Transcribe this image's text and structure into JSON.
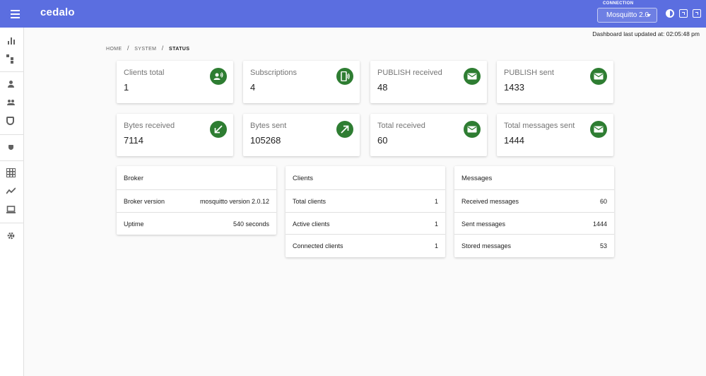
{
  "app": {
    "logo": "cedalo"
  },
  "connection": {
    "label": "CONNECTION",
    "selected": "Mosquitto 2.0"
  },
  "status": {
    "last_updated": "Dashboard last updated at: 02:05:48 pm"
  },
  "breadcrumb": {
    "items": [
      "HOME",
      "SYSTEM"
    ],
    "current": "STATUS"
  },
  "stats": [
    {
      "label": "Clients total",
      "value": "1",
      "icon": "person-voice-icon"
    },
    {
      "label": "Subscriptions",
      "value": "4",
      "icon": "phonelink-ring-icon"
    },
    {
      "label": "PUBLISH received",
      "value": "48",
      "icon": "mail-icon"
    },
    {
      "label": "PUBLISH sent",
      "value": "1433",
      "icon": "mail-icon"
    },
    {
      "label": "Bytes received",
      "value": "7114",
      "icon": "arrow-down-left-icon"
    },
    {
      "label": "Bytes sent",
      "value": "105268",
      "icon": "arrow-up-right-icon"
    },
    {
      "label": "Total received",
      "value": "60",
      "icon": "mail-icon"
    },
    {
      "label": "Total messages sent",
      "value": "1444",
      "icon": "mail-icon"
    }
  ],
  "broker": {
    "title": "Broker",
    "rows": [
      {
        "key": "Broker version",
        "value": "mosquitto version 2.0.12"
      },
      {
        "key": "Uptime",
        "value": "540 seconds"
      }
    ]
  },
  "clients": {
    "title": "Clients",
    "rows": [
      {
        "key": "Total clients",
        "value": "1"
      },
      {
        "key": "Active clients",
        "value": "1"
      },
      {
        "key": "Connected clients",
        "value": "1"
      }
    ]
  },
  "messages": {
    "title": "Messages",
    "rows": [
      {
        "key": "Received messages",
        "value": "60"
      },
      {
        "key": "Sent messages",
        "value": "1444"
      },
      {
        "key": "Stored messages",
        "value": "53"
      }
    ]
  },
  "colors": {
    "appbar": "#5b6ee0",
    "accent_icon": "#2e7d32"
  }
}
